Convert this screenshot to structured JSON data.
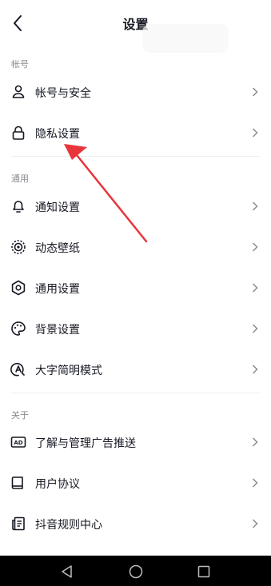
{
  "header": {
    "title": "设置"
  },
  "sections": [
    {
      "label": "帐号"
    },
    {
      "label": "通用"
    },
    {
      "label": "关于"
    }
  ],
  "items": [
    {
      "label": "帐号与安全",
      "icon": "person-icon"
    },
    {
      "label": "隐私设置",
      "icon": "lock-icon"
    },
    {
      "label": "通知设置",
      "icon": "bell-icon"
    },
    {
      "label": "动态壁纸",
      "icon": "live-wallpaper-icon"
    },
    {
      "label": "通用设置",
      "icon": "gear-icon"
    },
    {
      "label": "背景设置",
      "icon": "palette-icon"
    },
    {
      "label": "大字简明模式",
      "icon": "large-font-icon"
    },
    {
      "label": "了解与管理广告推送",
      "icon": "ad-icon"
    },
    {
      "label": "用户协议",
      "icon": "book-icon"
    },
    {
      "label": "抖音规则中心",
      "icon": "rules-document-icon"
    }
  ],
  "colors": {
    "text": "#161823",
    "secondary": "#8a8b91",
    "annotation_arrow": "#e8353a"
  },
  "system_nav": {
    "back": "nav-back-icon",
    "home": "nav-home-icon",
    "recents": "nav-recents-icon"
  }
}
